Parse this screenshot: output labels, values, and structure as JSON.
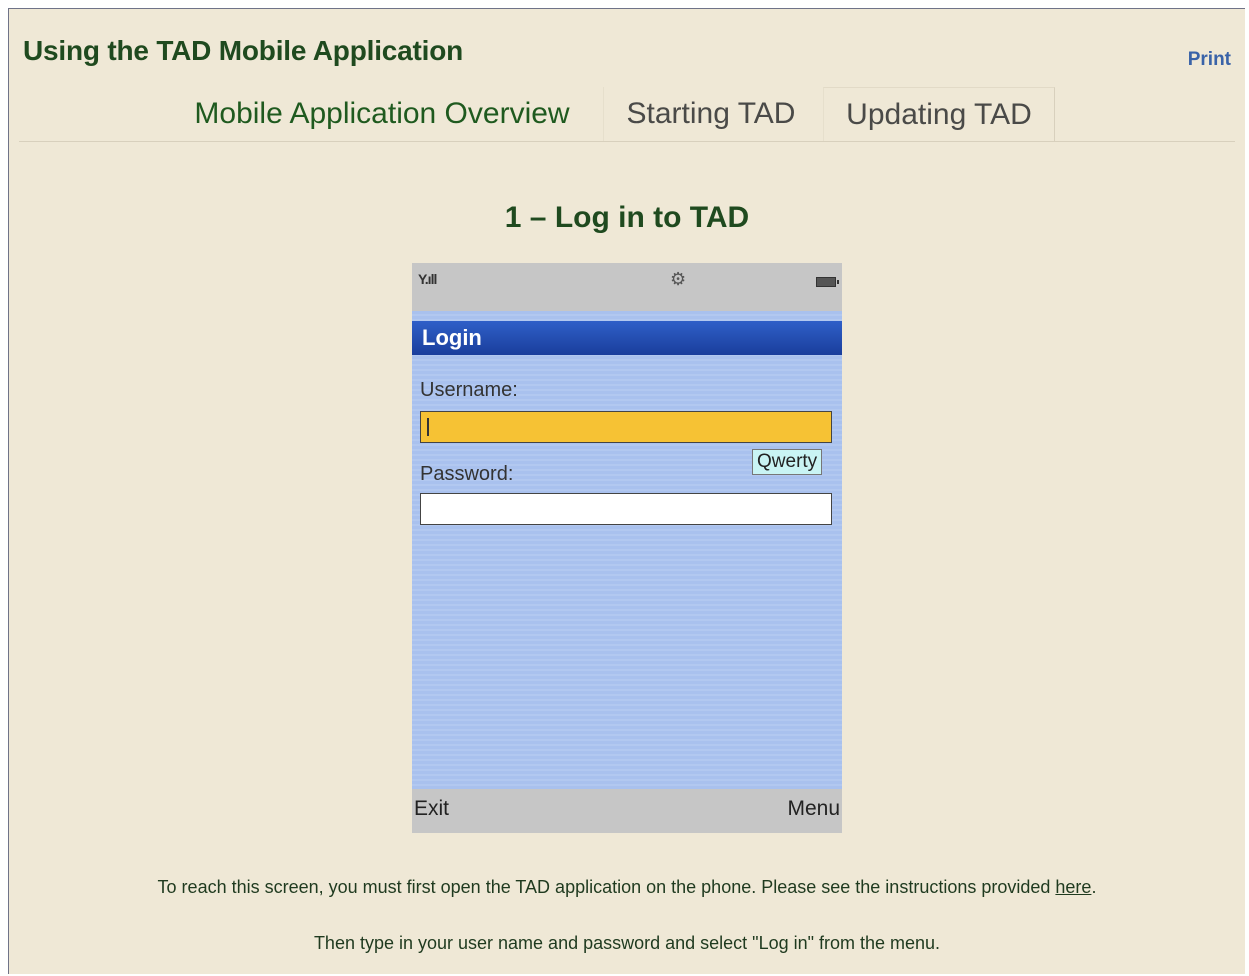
{
  "header": {
    "title": "Using the TAD Mobile Application",
    "print_label": "Print"
  },
  "tabs": [
    {
      "label": "Mobile Application Overview",
      "active": true
    },
    {
      "label": "Starting TAD",
      "active": false
    },
    {
      "label": "Updating TAD",
      "active": false
    }
  ],
  "step": {
    "heading": "1 – Log in to TAD"
  },
  "phone": {
    "signal_icon": "Y.ıll",
    "status_icons": [
      "signal-icon",
      "gear-icon",
      "battery-icon"
    ],
    "screen_title": "Login",
    "username_label": "Username:",
    "password_label": "Password:",
    "input_mode": "Qwerty",
    "softkey_left": "Exit",
    "softkey_right": "Menu"
  },
  "instructions": {
    "line1_text": "To reach this screen, you must first open the TAD application on the phone. Please see the instructions provided ",
    "line1_link": "here",
    "line1_end": ".",
    "line2": "Then type in your user name and password and select \"Log in\" from the menu."
  },
  "colors": {
    "title_green": "#1f4a1f",
    "background": "#efe8d6",
    "login_bar_blue": "#1a3e9c",
    "username_field": "#f6c234"
  }
}
